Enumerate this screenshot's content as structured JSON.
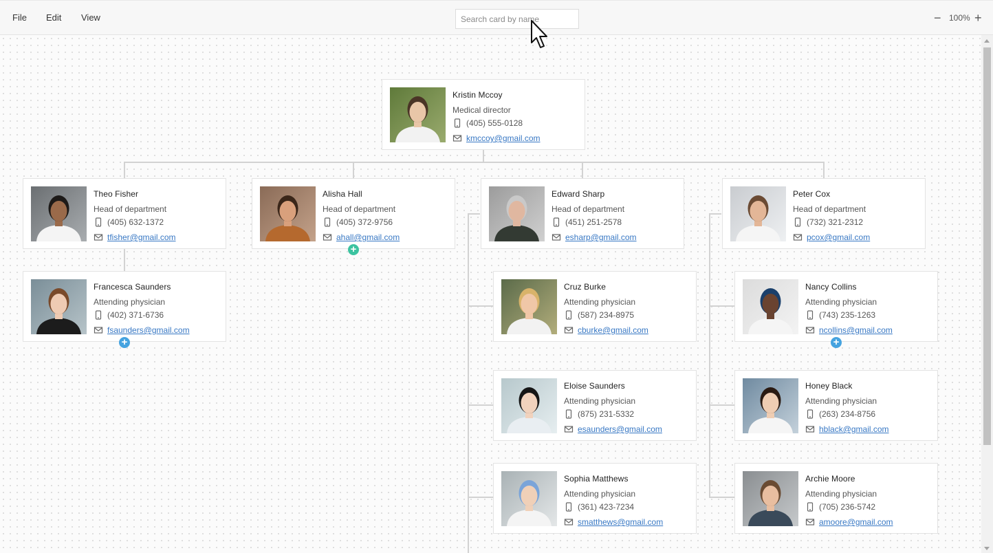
{
  "menu": {
    "file": "File",
    "edit": "Edit",
    "view": "View"
  },
  "search": {
    "placeholder": "Search card by name",
    "value": ""
  },
  "zoom": {
    "level": "100%",
    "minus": "−",
    "plus": "+"
  },
  "colors": {
    "accent_green": "#3cc3a0",
    "accent_blue": "#45a3e0",
    "email_link": "#3878c4",
    "connector": "#d2d2d2"
  },
  "cards": {
    "kristin": {
      "name": "Kristin Mccoy",
      "role": "Medical director",
      "phone": "(405) 555-0128",
      "email": "kmccoy@gmail.com"
    },
    "theo": {
      "name": "Theo Fisher",
      "role": "Head of department",
      "phone": "(405) 632-1372",
      "email": "tfisher@gmail.com"
    },
    "alisha": {
      "name": "Alisha Hall",
      "role": "Head of department",
      "phone": "(405) 372-9756",
      "email": "ahall@gmail.com"
    },
    "edward": {
      "name": "Edward Sharp",
      "role": "Head of department",
      "phone": "(451) 251-2578",
      "email": "esharp@gmail.com"
    },
    "peter": {
      "name": "Peter Cox",
      "role": "Head of department",
      "phone": "(732) 321-2312",
      "email": "pcox@gmail.com"
    },
    "francesca": {
      "name": "Francesca Saunders",
      "role": "Attending physician",
      "phone": "(402) 371-6736",
      "email": "fsaunders@gmail.com"
    },
    "cruz": {
      "name": "Cruz Burke",
      "role": "Attending physician",
      "phone": "(587) 234-8975",
      "email": "cburke@gmail.com"
    },
    "eloise": {
      "name": "Eloise Saunders",
      "role": "Attending physician",
      "phone": "(875) 231-5332",
      "email": "esaunders@gmail.com"
    },
    "sophia": {
      "name": "Sophia Matthews",
      "role": "Attending physician",
      "phone": "(361) 423-7234",
      "email": "smatthews@gmail.com"
    },
    "nancy": {
      "name": "Nancy Collins",
      "role": "Attending physician",
      "phone": "(743) 235-1263",
      "email": "ncollins@gmail.com"
    },
    "honey": {
      "name": "Honey Black",
      "role": "Attending physician",
      "phone": "(263) 234-8756",
      "email": "hblack@gmail.com"
    },
    "archie": {
      "name": "Archie Moore",
      "role": "Attending physician",
      "phone": "(705) 236-5742",
      "email": "amoore@gmail.com"
    }
  },
  "add_button_symbol": "+"
}
